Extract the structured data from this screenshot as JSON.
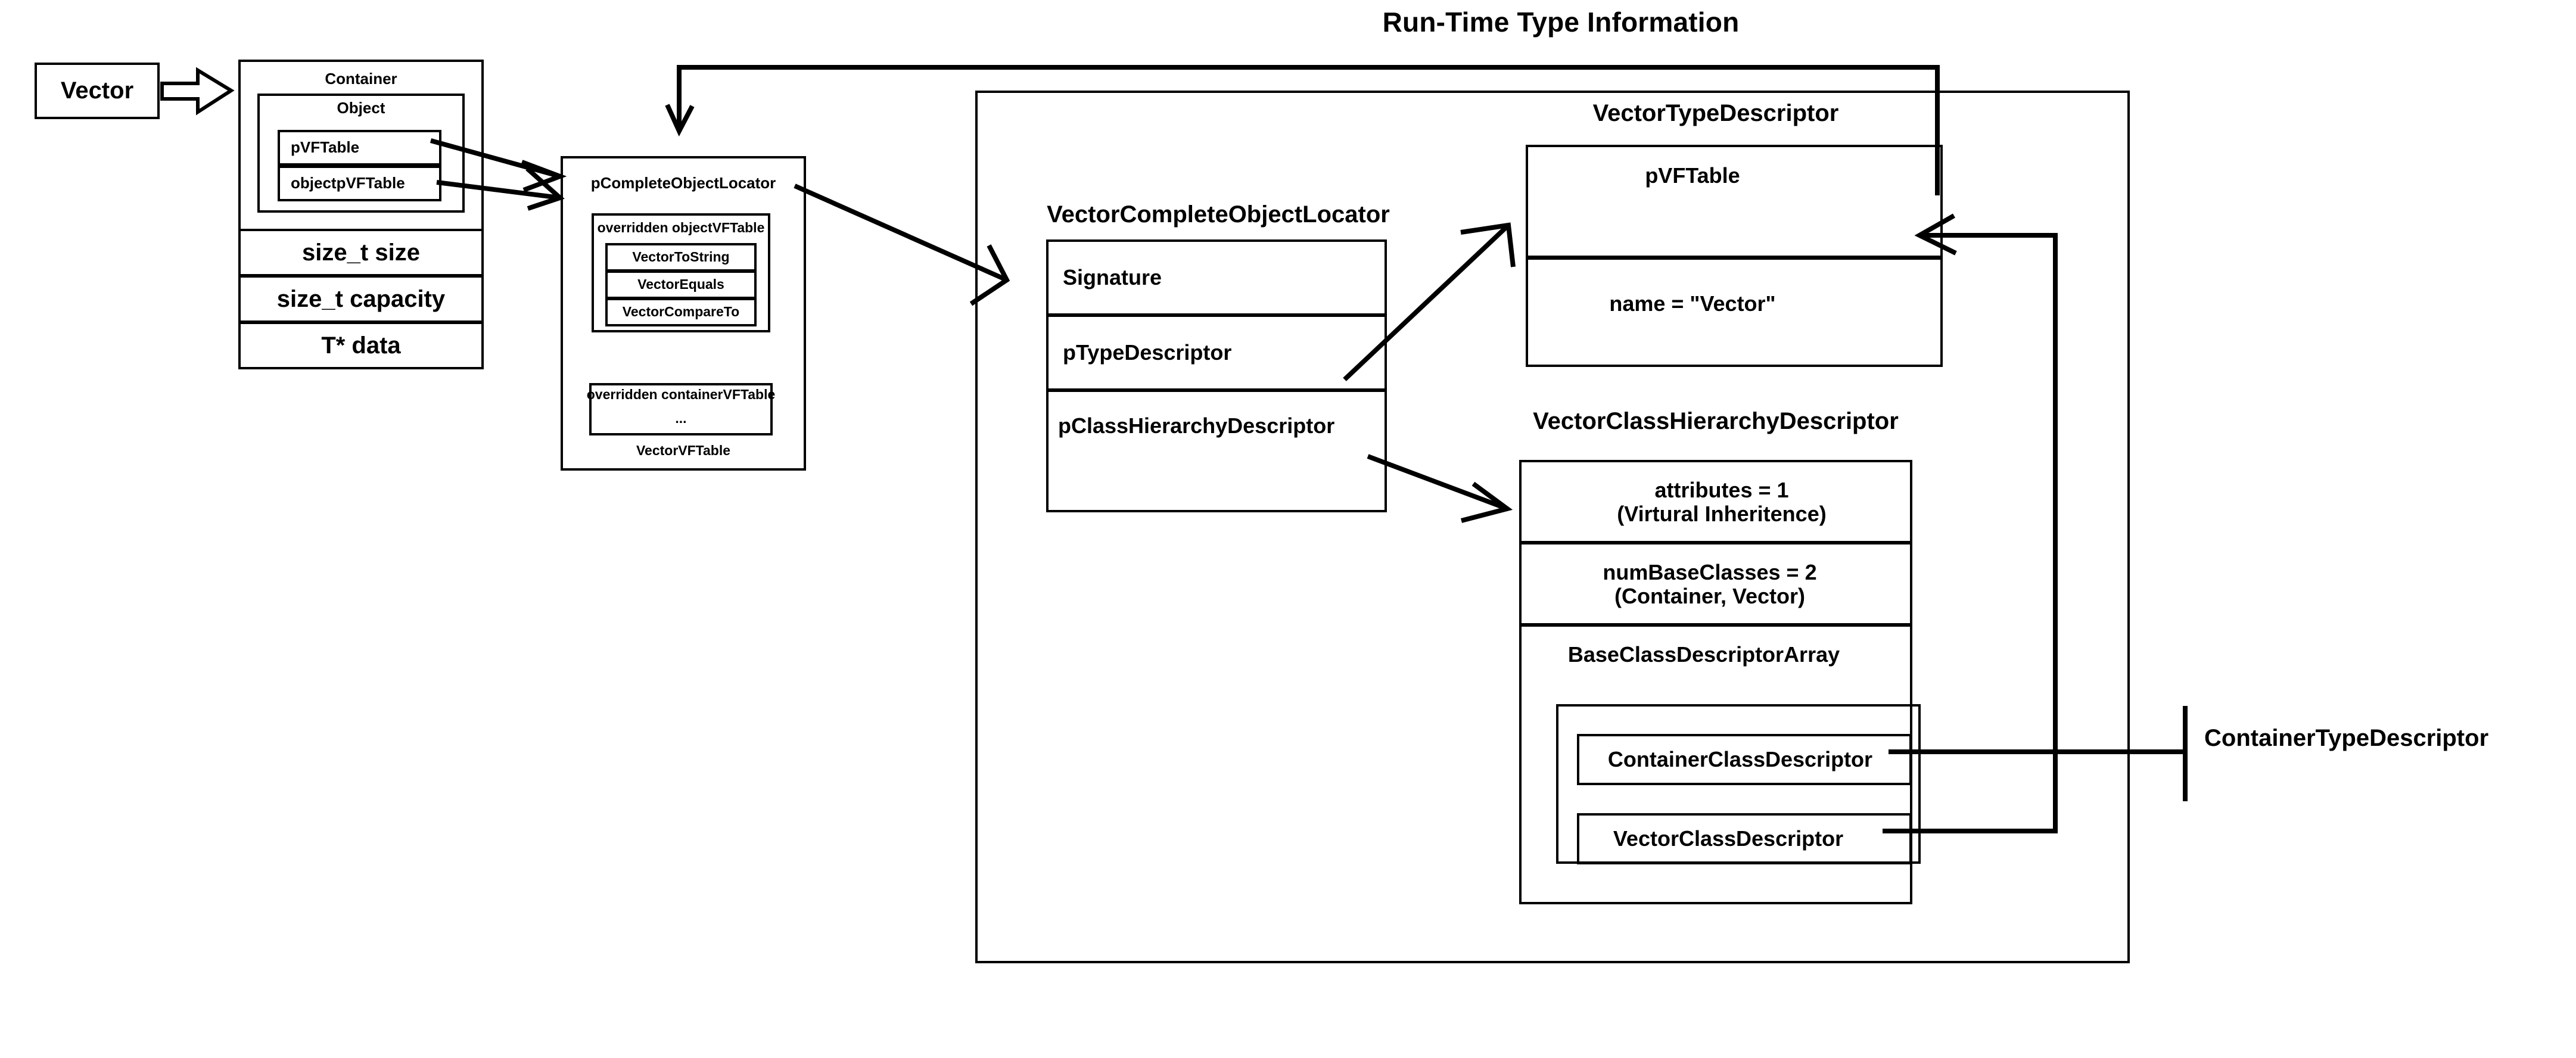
{
  "title": "Run-Time Type Information",
  "left_object": {
    "vector_box_label": "Vector",
    "container_label": "Container",
    "object_label": "Object",
    "object_fields": [
      "pVFTable",
      "objectpVFTable"
    ],
    "container_fields": [
      "size_t size",
      "size_t capacity",
      "T* data"
    ]
  },
  "vftable": {
    "header": "pCompleteObjectLocator",
    "object_vftable_label": "overridden objectVFTable",
    "object_vftable_entries": [
      "VectorToString",
      "VectorEquals",
      "VectorCompareTo"
    ],
    "container_vftable_label": "overridden containerVFTable",
    "container_vftable_ellipsis": "...",
    "footer": "VectorVFTable"
  },
  "complete_object_locator": {
    "title": "VectorCompleteObjectLocator",
    "rows": [
      "Signature",
      "pTypeDescriptor",
      "pClassHierarchyDescriptor"
    ]
  },
  "type_descriptor": {
    "title": "VectorTypeDescriptor",
    "rows": [
      "pVFTable",
      "name = \"Vector\""
    ]
  },
  "class_hierarchy_descriptor": {
    "title": "VectorClassHierarchyDescriptor",
    "rows": [
      "attributes = 1\n(Virtural Inheritence)",
      "numBaseClasses = 2\n(Container, Vector)"
    ],
    "array_label": "BaseClassDescriptorArray",
    "array_entries": [
      "ContainerClassDescriptor",
      "VectorClassDescriptor"
    ]
  },
  "external_labels": {
    "container_type_descriptor": "ContainerTypeDescriptor"
  },
  "colors": {
    "stroke": "#000000",
    "background": "#ffffff"
  }
}
